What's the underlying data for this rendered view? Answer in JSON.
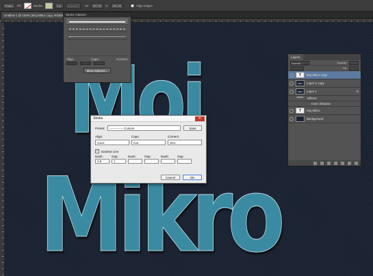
{
  "optionsbar": {
    "shape_mode": "Shape",
    "fill_label": "Fill:",
    "stroke_label": "Stroke:",
    "stroke_width": "3 pt",
    "w_label": "W:",
    "w_value": "827.94",
    "h_label": "H:",
    "h_value": "631.25",
    "align_edges": "Align Edges"
  },
  "document_tab": "Untitled-1 @ 100% (Moj Mikro copy, RGB/8)",
  "canvas": {
    "line1": "Moj",
    "line2": "Mikro"
  },
  "stroke_options": {
    "title": "Stroke Options",
    "align_label": "Align:",
    "caps_label": "Caps:",
    "corners_label": "Corners:",
    "more_button": "More Options..."
  },
  "stroke_dialog": {
    "title": "Stroke",
    "preset_label": "Preset:",
    "preset_value": "Custom",
    "save_button": "Save",
    "align_label": "Align:",
    "align_value": "Inside",
    "caps_label": "Caps:",
    "caps_value": "Butt",
    "corners_label": "Corners:",
    "corners_value": "Miter",
    "dashed_label": "Dashed Line",
    "dashed_checked": true,
    "dash_cols": [
      {
        "label": "Dash:",
        "value": "2.8"
      },
      {
        "label": "Gap:",
        "value": "1"
      },
      {
        "label": "Dash:",
        "value": ""
      },
      {
        "label": "Gap:",
        "value": ""
      },
      {
        "label": "Dash:",
        "value": ""
      },
      {
        "label": "Gap:",
        "value": ""
      }
    ],
    "cancel_button": "Cancel",
    "ok_button": "OK"
  },
  "layers_panel": {
    "tab": "Layers",
    "blend_mode": "Normal",
    "opacity_label": "Opacity:",
    "fill_label": "Fill:",
    "layers": [
      {
        "name": "Moj Mikro copy",
        "thumb": "T",
        "selected": true,
        "fx": ""
      },
      {
        "name": "Layer 1 copy",
        "thumb": "MOJ MIKRO",
        "selected": false,
        "fx": ""
      },
      {
        "name": "Layer 1",
        "thumb": "MOJ MIKRO",
        "selected": false,
        "fx": "fx"
      },
      {
        "name": "Moj Mikro",
        "thumb": "T",
        "selected": false,
        "fx": ""
      },
      {
        "name": "Background",
        "thumb": "",
        "selected": false,
        "fx": ""
      }
    ],
    "effects_label": "Effects",
    "inner_shadow_label": "Inner Shadow"
  }
}
